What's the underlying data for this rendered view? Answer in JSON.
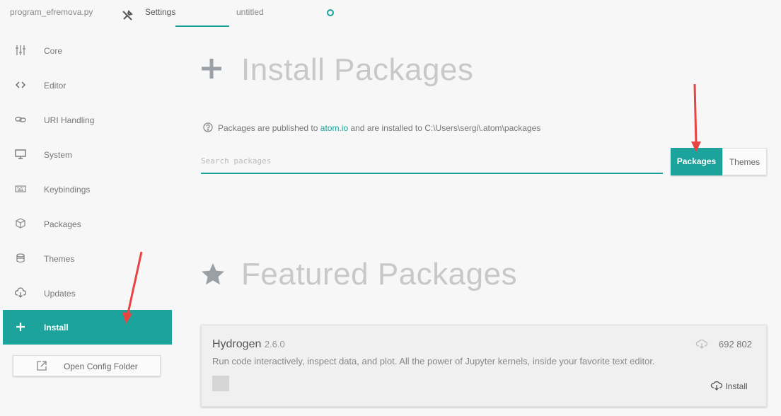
{
  "tabs": [
    {
      "label": "program_efremova.py"
    },
    {
      "label": "Settings"
    },
    {
      "label": "untitled"
    }
  ],
  "sidebar": {
    "items": [
      {
        "label": "Core",
        "icon": "sliders-icon"
      },
      {
        "label": "Editor",
        "icon": "code-icon"
      },
      {
        "label": "URI Handling",
        "icon": "link-icon"
      },
      {
        "label": "System",
        "icon": "monitor-icon"
      },
      {
        "label": "Keybindings",
        "icon": "keyboard-icon"
      },
      {
        "label": "Packages",
        "icon": "package-icon"
      },
      {
        "label": "Themes",
        "icon": "paintcan-icon"
      },
      {
        "label": "Updates",
        "icon": "cloud-download-icon"
      },
      {
        "label": "Install",
        "icon": "plus-icon"
      }
    ],
    "open_config_label": "Open Config Folder"
  },
  "install": {
    "title": "Install Packages",
    "hint_prefix": "Packages are published to ",
    "hint_link": "atom.io",
    "hint_suffix": " and are installed to C:\\Users\\sergi\\.atom\\packages",
    "search_placeholder": "Search packages",
    "toggle": {
      "packages": "Packages",
      "themes": "Themes"
    }
  },
  "featured": {
    "title": "Featured Packages",
    "packages": [
      {
        "name": "Hydrogen",
        "version": "2.6.0",
        "description": "Run code interactively, inspect data, and plot. All the power of Jupyter kernels, inside your favorite text editor.",
        "downloads": "692 802",
        "install_label": "Install"
      }
    ]
  },
  "colors": {
    "accent": "#1ba39c",
    "annotation_arrow": "#e84444"
  }
}
